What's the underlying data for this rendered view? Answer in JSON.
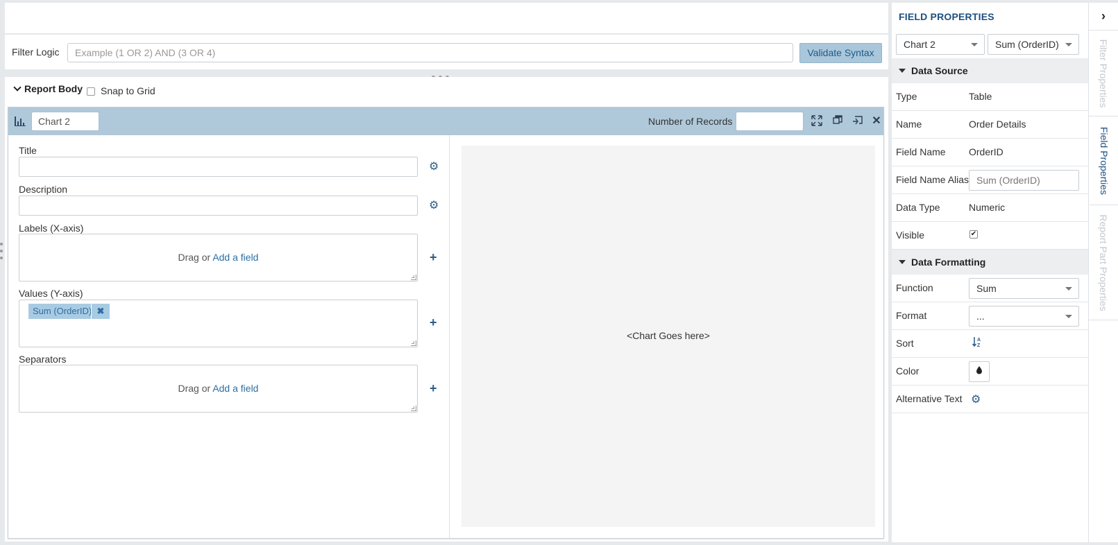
{
  "filter": {
    "label": "Filter Logic",
    "placeholder": "Example (1 OR 2) AND (3 OR 4)",
    "validate_label": "Validate Syntax"
  },
  "report_body": {
    "title": "Report Body",
    "snap_label": "Snap to Grid",
    "snap_checked": false
  },
  "chart_panel": {
    "name": "Chart 2",
    "records_label": "Number of Records",
    "records_value": "",
    "fields": {
      "title_label": "Title",
      "description_label": "Description",
      "labels_label": "Labels (X-axis)",
      "values_label": "Values (Y-axis)",
      "separators_label": "Separators",
      "drag_text": "Drag or ",
      "add_field_link": "Add a field",
      "value_chip": "Sum (OrderID)"
    },
    "preview_text": "<Chart Goes here>"
  },
  "field_properties": {
    "title": "FIELD PROPERTIES",
    "chart_select": "Chart 2",
    "field_select": "Sum (OrderID)",
    "data_source": {
      "header": "Data Source",
      "type_key": "Type",
      "type_val": "Table",
      "name_key": "Name",
      "name_val": "Order Details",
      "field_name_key": "Field Name",
      "field_name_val": "OrderID",
      "alias_key": "Field Name Alias",
      "alias_placeholder": "Sum (OrderID)",
      "data_type_key": "Data Type",
      "data_type_val": "Numeric",
      "visible_key": "Visible",
      "visible_checked": true
    },
    "data_formatting": {
      "header": "Data Formatting",
      "function_key": "Function",
      "function_val": "Sum",
      "format_key": "Format",
      "format_val": "...",
      "sort_key": "Sort",
      "color_key": "Color",
      "alt_text_key": "Alternative Text"
    }
  },
  "side_tabs": [
    {
      "label": "Filter Properties",
      "active": false
    },
    {
      "label": "Field Properties",
      "active": true
    },
    {
      "label": "Report Part Properties",
      "active": false
    }
  ],
  "icons": {
    "chart_type": "bar-chart-icon",
    "maximize": "expand-icon",
    "restore": "restore-window-icon",
    "copy": "copy-icon",
    "close": "close-icon",
    "gear": "gear-icon",
    "plus": "plus-icon",
    "sort": "sort-az-icon",
    "color": "color-drop-icon",
    "collapse": "chevron-right-icon"
  }
}
